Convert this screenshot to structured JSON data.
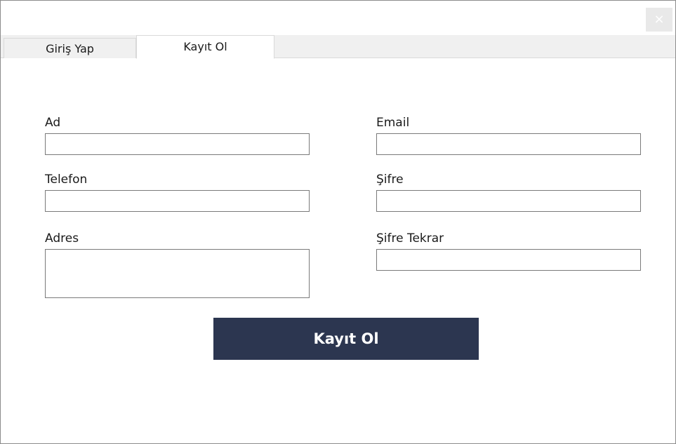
{
  "window": {
    "close_label": "×"
  },
  "tabs": [
    {
      "label": "Giriş Yap",
      "active": false
    },
    {
      "label": "Kayıt Ol",
      "active": true
    }
  ],
  "form": {
    "name": {
      "label": "Ad",
      "value": ""
    },
    "phone": {
      "label": "Telefon",
      "value": ""
    },
    "address": {
      "label": "Adres",
      "value": ""
    },
    "email": {
      "label": "Email",
      "value": ""
    },
    "password": {
      "label": "Şifre",
      "value": ""
    },
    "password_confirm": {
      "label": "Şifre Tekrar",
      "value": ""
    },
    "submit_label": "Kayıt Ol"
  },
  "colors": {
    "button_bg": "#2c3650",
    "button_text": "#ffffff"
  }
}
